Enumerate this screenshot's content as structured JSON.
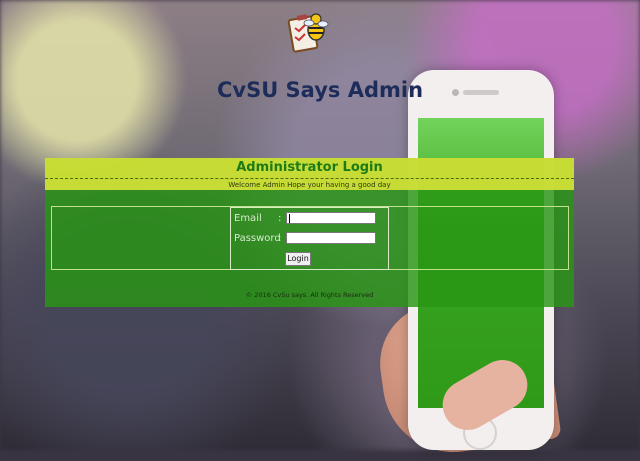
{
  "app": {
    "title": "CvSU Says Admin"
  },
  "login_panel": {
    "header_title": "Administrator Login",
    "welcome_text": "Welcome Admin Hope your having a good day",
    "email_label": "Email",
    "email_colon": ":",
    "email_value": "",
    "password_label": "Password",
    "password_colon": ":",
    "password_value": "",
    "login_button": "Login",
    "footer": "© 2016 CvSu says. All Rights Reserved"
  },
  "icons": {
    "logo": "bee-clipboard-logo-icon"
  }
}
